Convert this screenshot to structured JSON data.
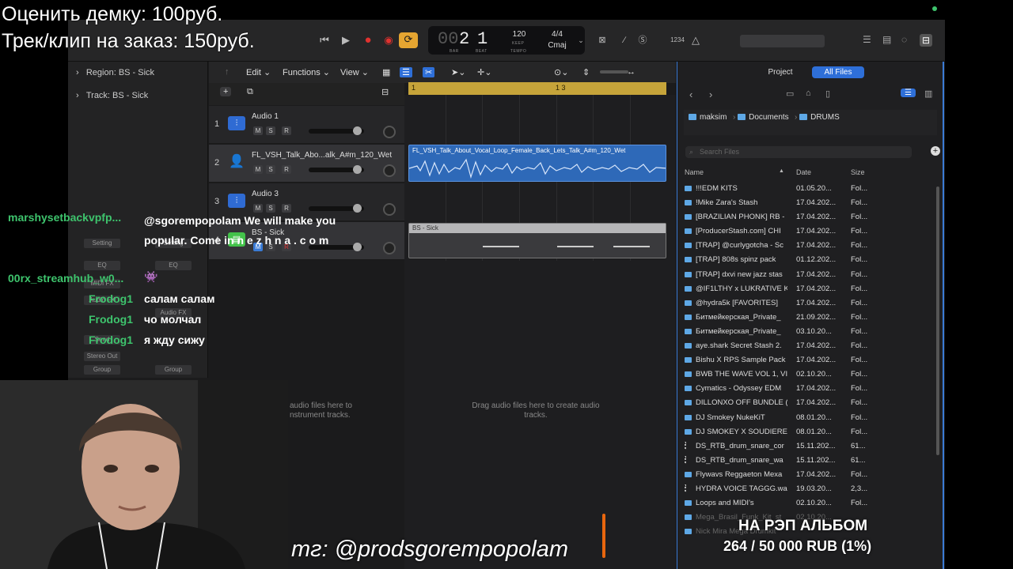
{
  "promo": {
    "line1": "Оценить демку: 100руб.",
    "line2": "Трек/клип на заказ: 150руб."
  },
  "transport": {
    "bar": "2",
    "beat": "1",
    "bar_prefix": "00",
    "bar_label": "BAR",
    "beat_label": "BEAT",
    "tempo": "120",
    "tempo_keep": "KEEP",
    "tempo_label": "TEMPO",
    "signature": "4/4",
    "key": "Cmaj",
    "count_in": "1234"
  },
  "inspector": {
    "region_label": "Region: BS - Sick",
    "track_label": "Track: BS - Sick",
    "setting": "Setting",
    "eq": "EQ",
    "midi_fx": "MIDI FX",
    "audio_fx": "Audio FX",
    "send": "Send",
    "stereo_out": "Stereo Out",
    "group": "Group"
  },
  "tracks_menu": {
    "edit": "Edit",
    "functions": "Functions",
    "view": "View"
  },
  "ruler": {
    "bar1": "1",
    "bar13": "1 3"
  },
  "tracks": [
    {
      "num": "1",
      "name": "Audio 1",
      "m": "M",
      "s": "S",
      "r": "R"
    },
    {
      "num": "2",
      "name": "FL_VSH_Talk_Abo...alk_A#m_120_Wet",
      "m": "M",
      "s": "S",
      "r": "R"
    },
    {
      "num": "3",
      "name": "Audio 3",
      "m": "M",
      "s": "S",
      "r": "R"
    },
    {
      "num": "4",
      "name": "BS - Sick",
      "m": "M",
      "s": "S",
      "r": "R"
    }
  ],
  "regions": {
    "audio": "FL_VSH_Talk_About_Vocal_Loop_Female_Back_Lets_Talk_A#m_120_Wet",
    "midi": "BS - Sick"
  },
  "arrange": {
    "drag_audio": "Drag audio files here to create audio tracks.",
    "drag_instrument": "audio files here to\nnstrument tracks."
  },
  "browser": {
    "tab_project": "Project",
    "tab_all": "All Files",
    "path": [
      "maksim",
      "Documents",
      "DRUMS"
    ],
    "search_placeholder": "Search Files",
    "col_name": "Name",
    "col_date": "Date",
    "col_size": "Size",
    "files": [
      {
        "name": "!!!EDM KITS",
        "date": "01.05.20...",
        "size": "Fol...",
        "type": "folder"
      },
      {
        "name": "!Mike Zara's Stash",
        "date": "17.04.202...",
        "size": "Fol...",
        "type": "folder"
      },
      {
        "name": "[BRAZILIAN PHONK] RB -",
        "date": "17.04.202...",
        "size": "Fol...",
        "type": "folder"
      },
      {
        "name": "[ProducerStash.com] CHI",
        "date": "17.04.202...",
        "size": "Fol...",
        "type": "folder"
      },
      {
        "name": "[TRAP] @curlygotcha - Sc",
        "date": "17.04.202...",
        "size": "Fol...",
        "type": "folder"
      },
      {
        "name": "[TRAP] 808s spinz pack",
        "date": "01.12.202...",
        "size": "Fol...",
        "type": "folder"
      },
      {
        "name": "[TRAP] dxvi new jazz stas",
        "date": "17.04.202...",
        "size": "Fol...",
        "type": "folder"
      },
      {
        "name": "@IF1LTHY x LUKRATIVE K",
        "date": "17.04.202...",
        "size": "Fol...",
        "type": "folder"
      },
      {
        "name": "@hydra5k [FAVORITES]",
        "date": "17.04.202...",
        "size": "Fol...",
        "type": "folder"
      },
      {
        "name": "Битмейкерская_Private_",
        "date": "21.09.202...",
        "size": "Fol...",
        "type": "folder"
      },
      {
        "name": "Битмейкерская_Private_",
        "date": "03.10.20...",
        "size": "Fol...",
        "type": "folder"
      },
      {
        "name": "aye.shark Secret Stash 2.",
        "date": "17.04.202...",
        "size": "Fol...",
        "type": "folder"
      },
      {
        "name": "Bishu X RPS Sample Pack",
        "date": "17.04.202...",
        "size": "Fol...",
        "type": "folder"
      },
      {
        "name": "BWB THE WAVE VOL 1, VI",
        "date": "02.10.20...",
        "size": "Fol...",
        "type": "folder"
      },
      {
        "name": "Cymatics - Odyssey EDM",
        "date": "17.04.202...",
        "size": "Fol...",
        "type": "folder"
      },
      {
        "name": "DILLONXO OFF BUNDLE (",
        "date": "17.04.202...",
        "size": "Fol...",
        "type": "folder"
      },
      {
        "name": "DJ Smokey NukeKiT",
        "date": "08.01.20...",
        "size": "Fol...",
        "type": "folder"
      },
      {
        "name": "DJ SMOKEY X SOUDIERE",
        "date": "08.01.20...",
        "size": "Fol...",
        "type": "folder"
      },
      {
        "name": "DS_RTB_drum_snare_cor",
        "date": "15.11.202...",
        "size": "61...",
        "type": "file"
      },
      {
        "name": "DS_RTB_drum_snare_wa",
        "date": "15.11.202...",
        "size": "61...",
        "type": "file"
      },
      {
        "name": "Flywavs Reggaeton Mexa",
        "date": "17.04.202...",
        "size": "Fol...",
        "type": "folder"
      },
      {
        "name": "HYDRA VOICE TAGGG.wa",
        "date": "19.03.20...",
        "size": "2,3...",
        "type": "file"
      },
      {
        "name": "Loops and MIDI's",
        "date": "02.10.20...",
        "size": "Fol...",
        "type": "folder"
      },
      {
        "name": "Mega_Brasil_Funk_Kit_st",
        "date": "02.10.20...",
        "size": "",
        "type": "folder"
      },
      {
        "name": "Nick Mira Mega Drumkit",
        "date": "",
        "size": "",
        "type": "folder"
      }
    ]
  },
  "chat": [
    {
      "user": "marshysetbackvpfp...",
      "msg": "@sgorempopolam We will make you popular. Come in  n e z  h n a . c o m"
    },
    {
      "user": "00rx_streamhub_w0...",
      "msg": ""
    },
    {
      "user": "Frodog1",
      "msg": "салам салам"
    },
    {
      "user": "Frodog1",
      "msg": "чо молчал"
    },
    {
      "user": "Frodog1",
      "msg": "я жду сижу"
    }
  ],
  "stream": {
    "telegram": "тг: @prodsgorempopolam",
    "album_title": "НА РЭП АЛЬБОМ",
    "album_progress_text": "264 / 50 000 RUB (1%)",
    "album_progress": 0.01
  },
  "colors": {
    "accent": "#2e6fd8",
    "record": "#e0322f",
    "cycle": "#e5a531",
    "region_audio": "#2e69b8",
    "chat_user": "#3ec46d"
  }
}
